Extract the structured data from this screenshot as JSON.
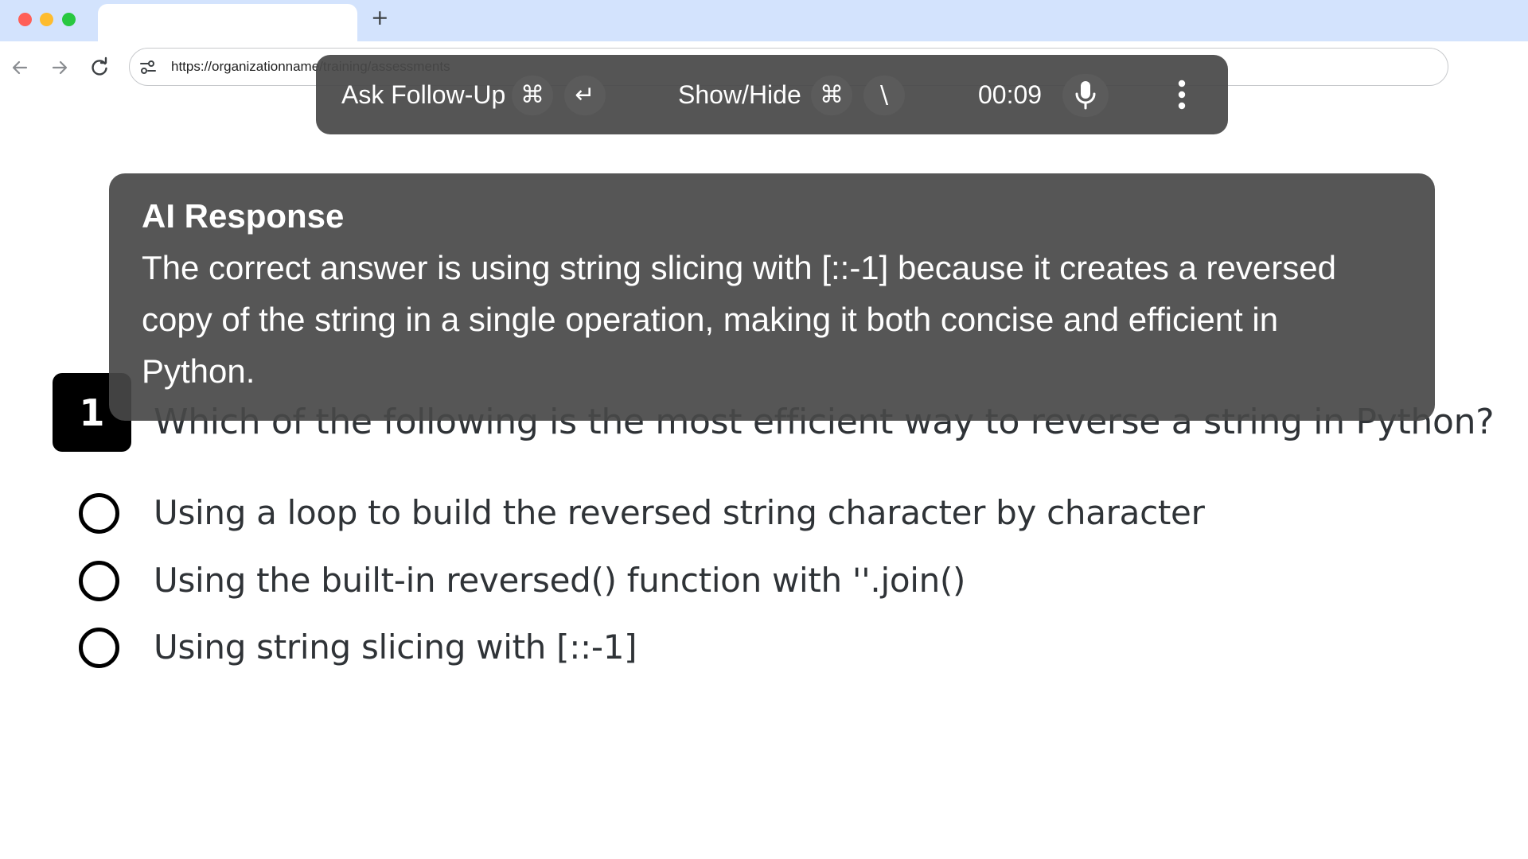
{
  "browser": {
    "url": "https://organizationname/training/assessments",
    "new_tab_label": "+"
  },
  "overlay_bar": {
    "ask_followup_label": "Ask Follow-Up",
    "ask_followup_keys": [
      "⌘",
      "↵"
    ],
    "show_hide_label": "Show/Hide",
    "show_hide_keys": [
      "⌘",
      "\\"
    ],
    "timer": "00:09"
  },
  "ai_response": {
    "title": "AI Response",
    "body": "The correct answer is using string slicing with [::-1] because it creates a reversed copy of the string in a single operation, making it both concise and efficient in Python."
  },
  "question": {
    "number": "1",
    "text": "Which of the following is the most efficient way to reverse a string in Python?",
    "options": [
      {
        "label": "Using a loop to build the reversed string character by character",
        "selected": false
      },
      {
        "label": "Using the built-in reversed() function with ''.join()",
        "selected": false
      },
      {
        "label": "Using string slicing with [::-1]",
        "selected": false
      }
    ]
  },
  "colors": {
    "tabstrip": "#d3e3fd",
    "overlay": "#484848",
    "badge": "#000000",
    "text": "#2f3337"
  }
}
